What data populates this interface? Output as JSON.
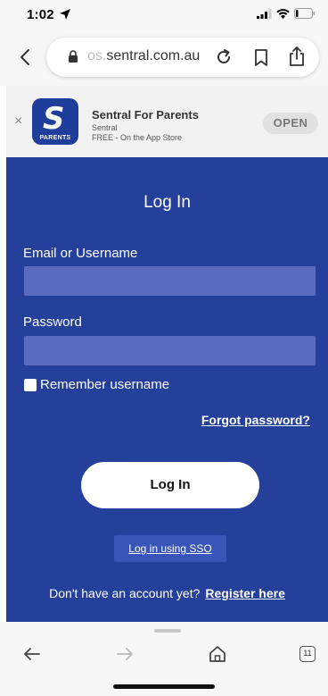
{
  "status_bar": {
    "time": "1:02"
  },
  "browser": {
    "url_faded": "os.",
    "url_main": "sentral.com.au",
    "tabs_count": "11"
  },
  "app_banner": {
    "app_name": "Sentral For Parents",
    "developer": "Sentral",
    "price": "FREE - On the App Store",
    "icon_label": "PARENTS",
    "icon_letter": "S",
    "open_label": "OPEN",
    "close_label": "×"
  },
  "login": {
    "title": "Log In",
    "email_label": "Email or Username",
    "email_value": "",
    "password_label": "Password",
    "password_value": "",
    "remember_label": "Remember username",
    "remember_checked": false,
    "forgot_label": "Forgot password?",
    "login_button": "Log In",
    "sso_label": "Log in using SSO",
    "register_prompt": "Don't have an account yet?",
    "register_link": "Register here"
  },
  "colors": {
    "panel_bg": "#24409a",
    "input_bg": "#5a6bc0",
    "sso_bg": "#3a55b8"
  },
  "icons": [
    "location-arrow-icon",
    "signal-icon",
    "wifi-icon",
    "battery-icon",
    "back-chevron-icon",
    "lock-icon",
    "reload-icon",
    "bookmark-icon",
    "share-icon",
    "close-icon",
    "back-arrow-icon",
    "forward-arrow-icon",
    "home-icon",
    "tabs-icon"
  ]
}
